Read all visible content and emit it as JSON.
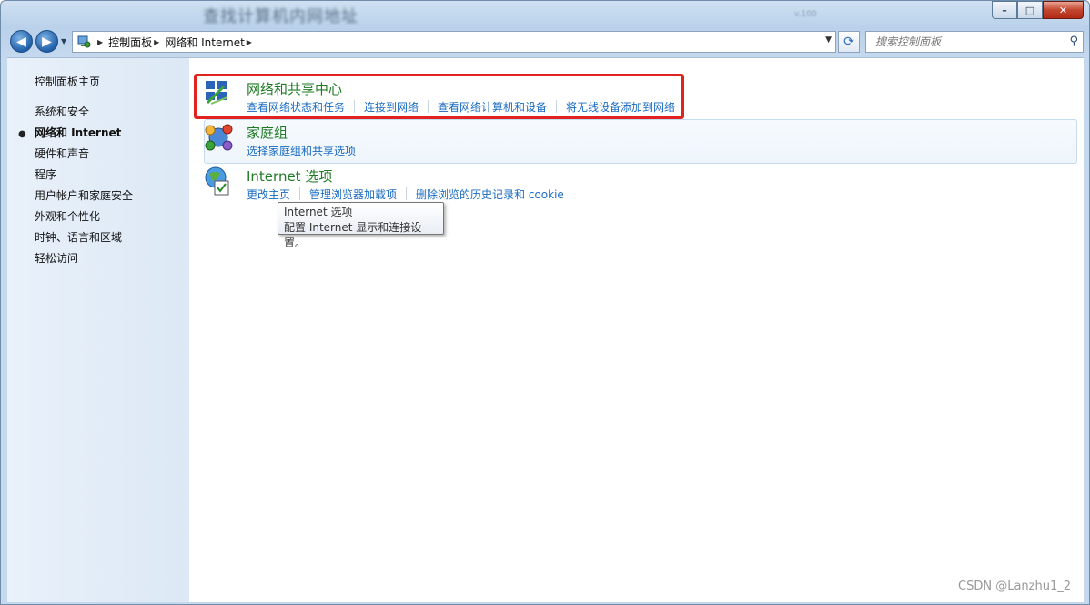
{
  "window": {
    "title": "查找计算机内网地址",
    "title_faint": "v.100"
  },
  "caption": {
    "minimize": "–",
    "maximize": "□",
    "close": "✕"
  },
  "address": {
    "root_icon": "control-panel-icon",
    "crumbs": [
      "控制面板",
      "网络和 Internet"
    ],
    "sep": "▶"
  },
  "search": {
    "placeholder": "搜索控制面板"
  },
  "sidebar": {
    "items": [
      {
        "label": "控制面板主页"
      },
      {
        "label": "系统和安全"
      },
      {
        "label": "网络和 Internet",
        "active": true
      },
      {
        "label": "硬件和声音"
      },
      {
        "label": "程序"
      },
      {
        "label": "用户帐户和家庭安全"
      },
      {
        "label": "外观和个性化"
      },
      {
        "label": "时钟、语言和区域"
      },
      {
        "label": "轻松访问"
      }
    ]
  },
  "categories": [
    {
      "title": "网络和共享中心",
      "icon": "network-sharing-center-icon",
      "links": [
        "查看网络状态和任务",
        "连接到网络",
        "查看网络计算机和设备",
        "将无线设备添加到网络"
      ]
    },
    {
      "title": "家庭组",
      "icon": "homegroup-icon",
      "links": [
        "选择家庭组和共享选项"
      ]
    },
    {
      "title": "Internet 选项",
      "icon": "internet-options-icon",
      "links": [
        "更改主页",
        "管理浏览器加载项",
        "删除浏览的历史记录和 cookie"
      ]
    }
  ],
  "tooltip": {
    "line1": "Internet 选项",
    "line2": "配置 Internet 显示和连接设置。"
  },
  "watermark": "CSDN @Lanzhu1_2",
  "colors": {
    "highlight_box": "#e0231e",
    "category_title": "#1e7b24",
    "link": "#1a6bc1"
  }
}
